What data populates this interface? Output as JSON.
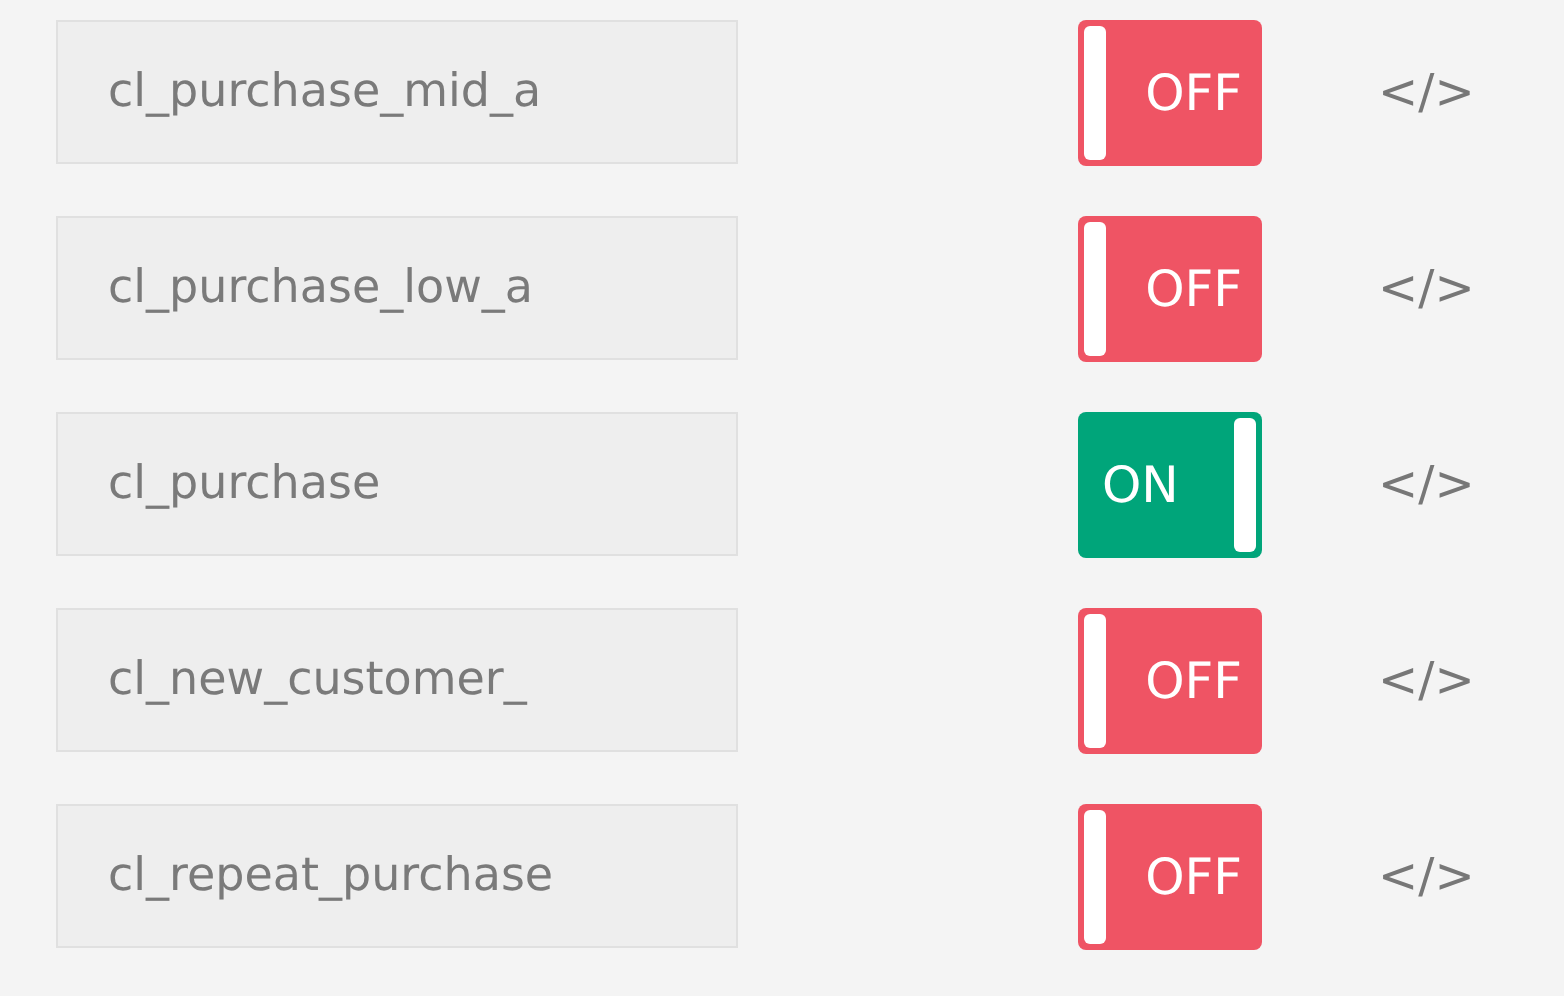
{
  "rows": [
    {
      "name": "cl_purchase_mid_a",
      "on": false,
      "toggle_label": "OFF",
      "code": "</>"
    },
    {
      "name": "cl_purchase_low_a",
      "on": false,
      "toggle_label": "OFF",
      "code": "</>"
    },
    {
      "name": "cl_purchase",
      "on": true,
      "toggle_label": "ON",
      "code": "</>"
    },
    {
      "name": "cl_new_customer_",
      "on": false,
      "toggle_label": "OFF",
      "code": "</>"
    },
    {
      "name": "cl_repeat_purchase",
      "on": false,
      "toggle_label": "OFF",
      "code": "</>"
    }
  ]
}
